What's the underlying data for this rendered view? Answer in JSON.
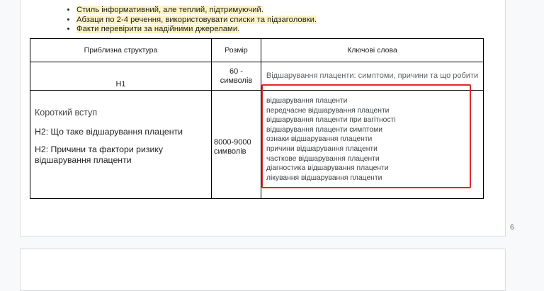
{
  "bullets": [
    "Стиль  інформативний, але теплий, підтримуючий.",
    "Абзаци по 2-4 речення, використовувати списки та підзаголовки.",
    "Факти перевірити за надійними джерелами."
  ],
  "table": {
    "headers": [
      "Приблизна структура",
      "Розмір",
      "Ключові слова"
    ],
    "row1": {
      "structure": "H1",
      "size": "60 - символів",
      "keywords": "Відшарування плаценти: симптоми, причини та що робити"
    },
    "row2": {
      "intro": "Короткий вступ",
      "h2_1": "H2: Що таке відшарування плаценти",
      "h2_2": "H2: Причини та фактори ризику відшарування плаценти",
      "size": "8000-9000 символів",
      "keywords": [
        "відшарування плаценти",
        "передчасне відшарування плаценти",
        "відшарування плаценти при вагітності",
        "відшарування плаценти симптоми",
        "ознаки відшарування плаценти",
        "причини відшарування плаценти",
        "часткове відшарування плаценти",
        "діагностика відшарування плаценти",
        "лікування відшарування плаценти"
      ]
    }
  },
  "page_number": "6",
  "colors": {
    "highlight": "#fdf3c4",
    "annotation_box": "#e3262b"
  }
}
